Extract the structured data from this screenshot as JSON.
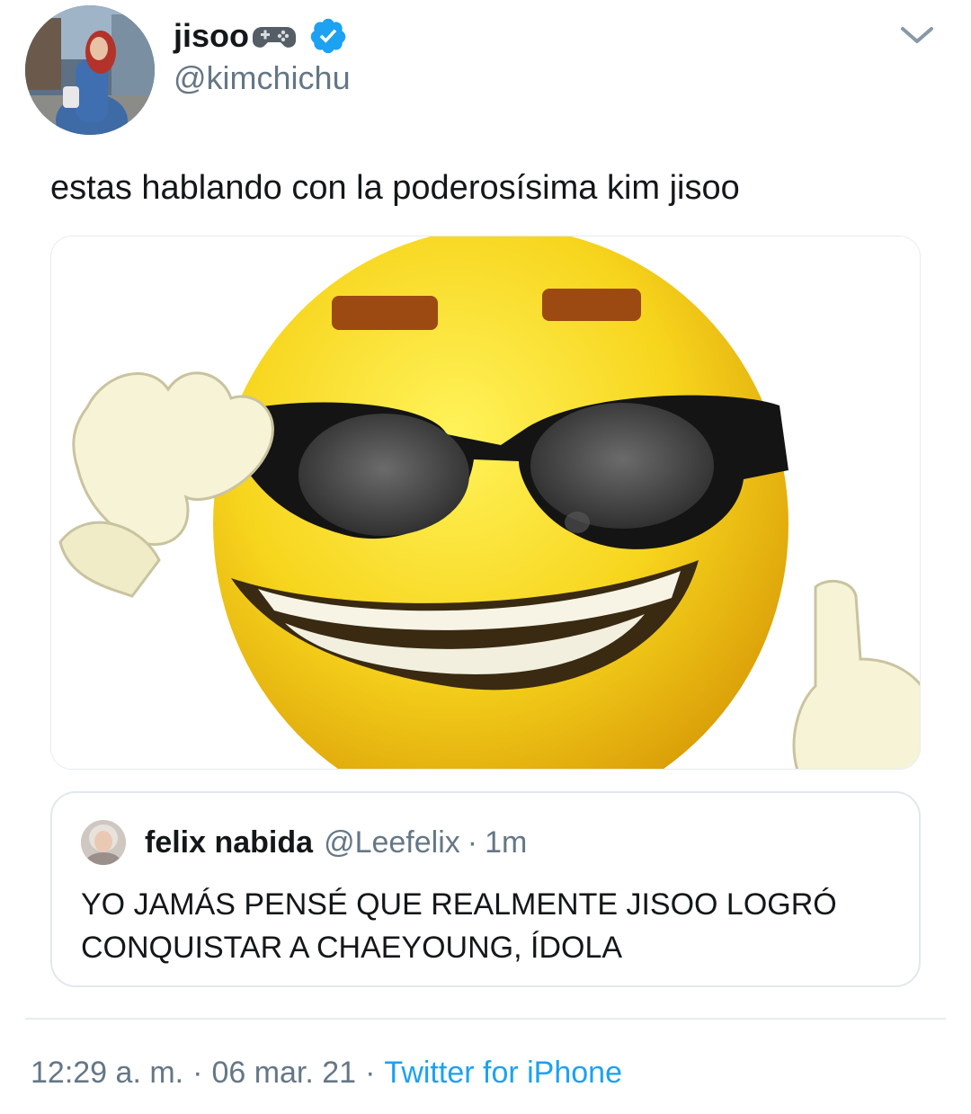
{
  "author": {
    "display_name": "jisoo",
    "handle": "@kimchichu",
    "name_emoji": "video-game-icon",
    "verified_icon": "verified-badge-icon"
  },
  "tweet": {
    "text": "estas hablando con la poderosísima kim jisoo",
    "media_icon": "cool-emoji-sunglasses-thumbs-up-image"
  },
  "quote": {
    "display_name": "felix nabida",
    "handle": "@Leefelix",
    "separator": "·",
    "time": "1m",
    "text": "YO JAMÁS PENSÉ QUE REALMENTE JISOO LOGRÓ CONQUISTAR A CHAEYOUNG, ÍDOLA"
  },
  "meta": {
    "time": "12:29 a. m.",
    "sep1": "·",
    "date": "06 mar. 21",
    "sep2": "·",
    "source": "Twitter for iPhone"
  },
  "colors": {
    "text": "#14171a",
    "secondary": "#657786",
    "accent": "#1da1f2",
    "border": "#e1e8ed",
    "emoji_yellow": "#f7d51d"
  }
}
